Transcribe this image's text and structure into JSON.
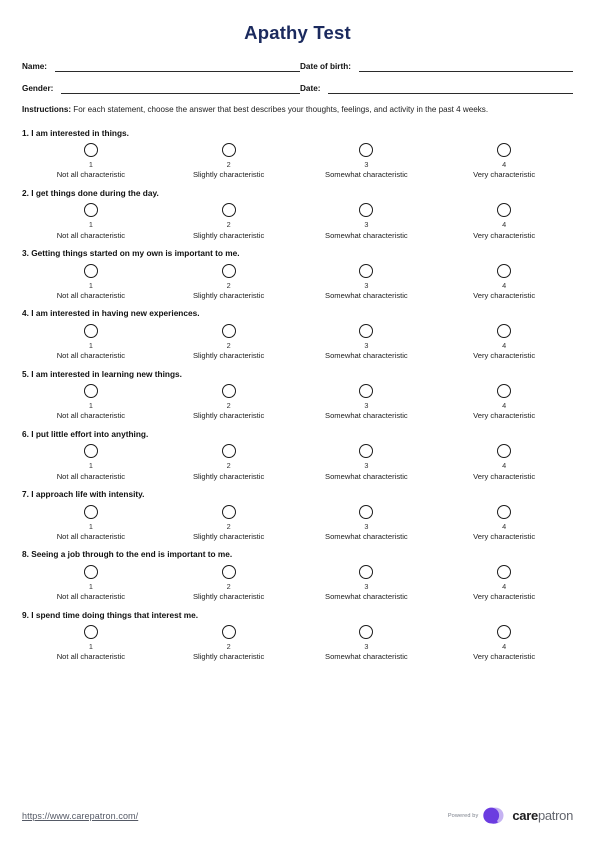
{
  "document": {
    "title": "Apathy Test",
    "title_color": "#1b2a5e"
  },
  "fields": [
    {
      "label": "Name:",
      "value": ""
    },
    {
      "label": "Date of birth:",
      "value": ""
    },
    {
      "label": "Gender:",
      "value": ""
    },
    {
      "label": "Date:",
      "value": ""
    }
  ],
  "instructions": {
    "label": "Instructions:",
    "text": " For each statement, choose the answer that best describes your thoughts, feelings, and activity in the past 4 weeks."
  },
  "scale": [
    {
      "number": "1",
      "label": "Not all characteristic"
    },
    {
      "number": "2",
      "label": "Slightly characteristic"
    },
    {
      "number": "3",
      "label": "Somewhat characteristic"
    },
    {
      "number": "4",
      "label": "Very characteristic"
    }
  ],
  "questions": [
    {
      "text": "1. I am interested in things."
    },
    {
      "text": "2. I get things done during the day."
    },
    {
      "text": "3. Getting things started on my own is important to me."
    },
    {
      "text": "4. I am interested in having new experiences."
    },
    {
      "text": "5. I am interested in learning new things."
    },
    {
      "text": "6. I put little effort into anything."
    },
    {
      "text": "7. I approach life with intensity."
    },
    {
      "text": "8. Seeing a job through to the end is important to me."
    },
    {
      "text": "9. I spend time doing things that interest me."
    }
  ],
  "footer": {
    "url": "https://www.carepatron.com/",
    "powered_by": "Powered by",
    "brand_bold": "care",
    "brand_light": "patron",
    "brand_color_dark": "#6b3ce0",
    "brand_color_light": "#c5b2f2"
  }
}
